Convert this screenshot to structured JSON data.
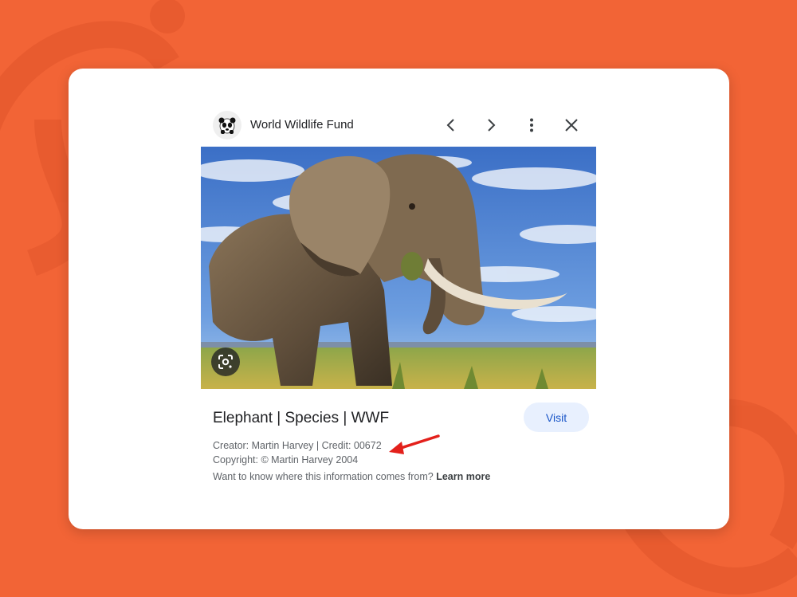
{
  "panel": {
    "site_name": "World Wildlife Fund",
    "logo_icon": "panda-logo-icon",
    "nav": {
      "prev_icon": "chevron-left-icon",
      "next_icon": "chevron-right-icon",
      "more_icon": "more-vert-icon",
      "close_icon": "close-icon"
    },
    "image_alt_icon": "google-lens-icon",
    "title": "Elephant | Species | WWF",
    "visit_label": "Visit",
    "creator_line": "Creator: Martin Harvey | Credit: 00672",
    "copyright_line": "Copyright: © Martin Harvey 2004",
    "info_prefix": "Want to know where this information comes from?",
    "learn_more_label": "Learn more"
  },
  "colors": {
    "background": "#f26436",
    "visit_button_bg": "#e8f0fe",
    "visit_button_text": "#1a56c8",
    "annotation_arrow": "#e3201b"
  }
}
